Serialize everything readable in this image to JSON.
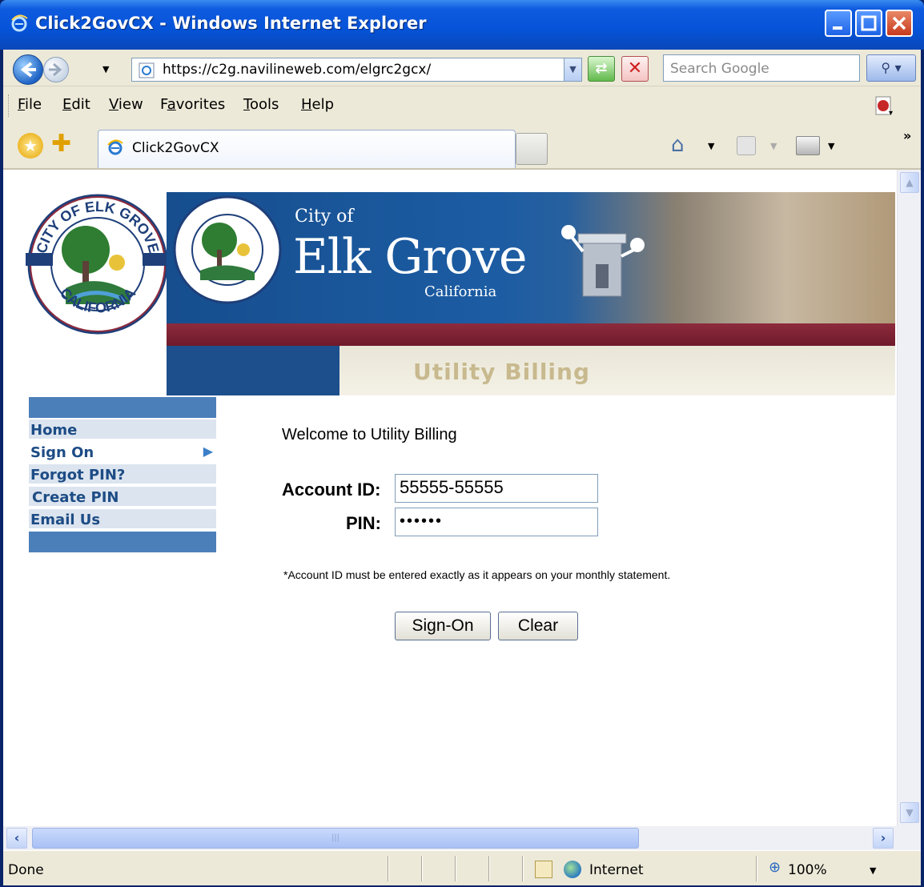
{
  "window": {
    "title": "Click2GovCX - Windows Internet Explorer",
    "minimize_icon": "minimize-icon",
    "maximize_icon": "maximize-icon",
    "close_icon": "close-icon"
  },
  "navbar": {
    "address": "https://c2g.navilineweb.com/elgrc2gcx/",
    "search_placeholder": "Search Google"
  },
  "menu": {
    "items": [
      "File",
      "Edit",
      "View",
      "Favorites",
      "Tools",
      "Help"
    ]
  },
  "tabs": {
    "active_label": "Click2GovCX",
    "overflow": "»"
  },
  "page": {
    "banner": {
      "city_of": "City of",
      "city_name": "Elk Grove",
      "state": "California",
      "section_title": "Utility Billing"
    },
    "seal_text": {
      "top": "CITY OF ELK GROVE",
      "bottom": "CALIFORNIA"
    },
    "side_menu": {
      "items": [
        "Home",
        "Sign On",
        "Forgot PIN?",
        "Create PIN",
        "Email Us"
      ],
      "active_index": 1
    },
    "welcome": "Welcome to Utility Billing",
    "form": {
      "account_label": "Account ID:",
      "account_value": "55555-55555",
      "pin_label": "PIN:",
      "pin_value": "••••••",
      "note": "*Account ID must be entered exactly as it appears on your monthly statement.",
      "signon_label": "Sign-On",
      "clear_label": "Clear"
    }
  },
  "statusbar": {
    "status": "Done",
    "zone": "Internet",
    "zoom": "100%"
  },
  "colors": {
    "titlebar": "#0553D8",
    "banner_blue": "#1C5CA3",
    "maroon": "#8D2B3D",
    "menu_link": "#1D4C85"
  }
}
